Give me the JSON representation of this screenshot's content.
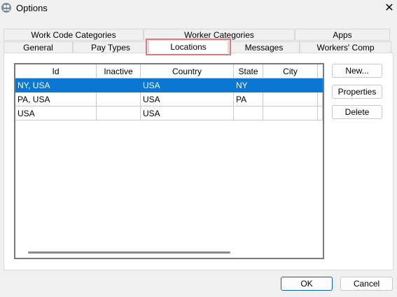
{
  "window": {
    "title": "Options",
    "close_glyph": "✕"
  },
  "tabs_row1": [
    {
      "label": "Work Code Categories"
    },
    {
      "label": "Worker Categories"
    },
    {
      "label": "Apps"
    }
  ],
  "tabs_row2": [
    {
      "label": "General"
    },
    {
      "label": "Pay Types"
    },
    {
      "label": "Locations",
      "active": true
    },
    {
      "label": "Messages"
    },
    {
      "label": "Workers' Comp"
    }
  ],
  "table": {
    "columns": [
      "Id",
      "Inactive",
      "Country",
      "State",
      "City"
    ],
    "rows": [
      {
        "id": "NY, USA",
        "inactive": "",
        "country": "USA",
        "state": "NY",
        "city": "",
        "selected": true
      },
      {
        "id": "PA, USA",
        "inactive": "",
        "country": "USA",
        "state": "PA",
        "city": ""
      },
      {
        "id": "USA",
        "inactive": "",
        "country": "USA",
        "state": "",
        "city": ""
      }
    ]
  },
  "side_buttons": {
    "new": "New...",
    "properties": "Properties",
    "delete": "Delete"
  },
  "footer": {
    "ok": "OK",
    "cancel": "Cancel"
  },
  "colors": {
    "selection": "#0a77d3",
    "highlight_box": "#e07b7b"
  }
}
